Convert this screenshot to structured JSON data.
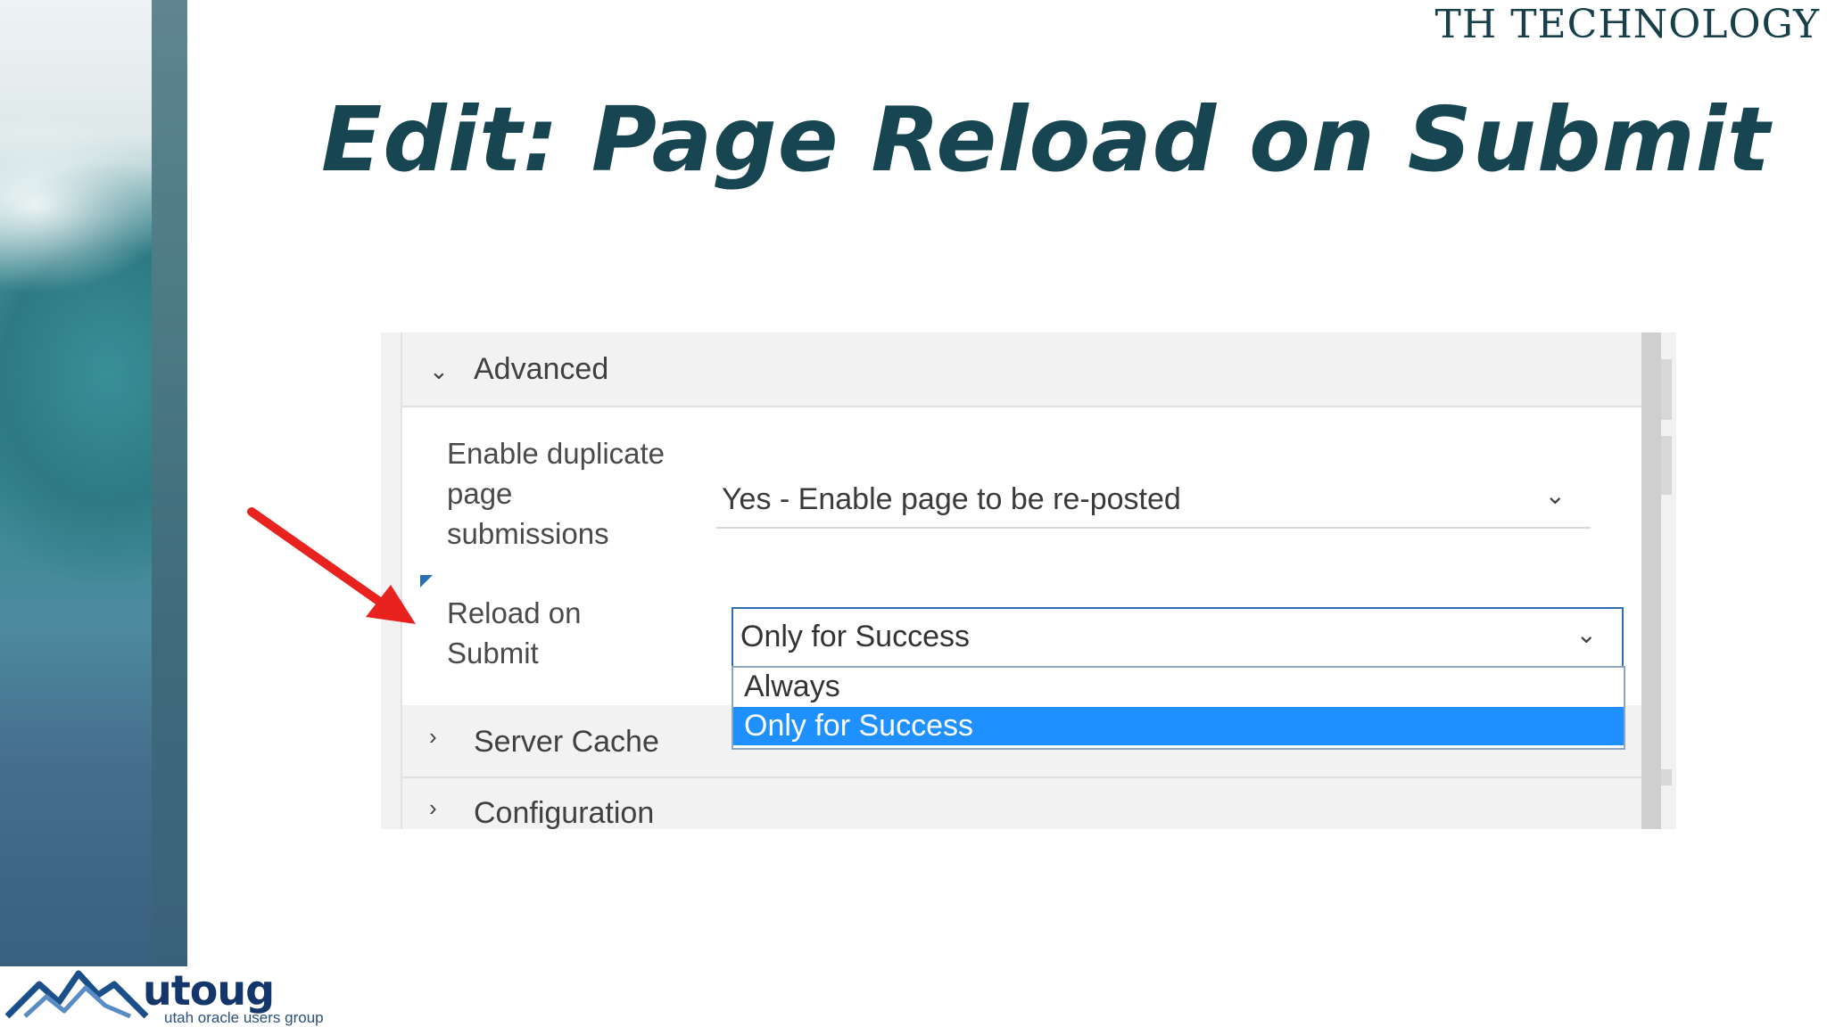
{
  "brand": "TH TECHNOLOGY",
  "slide_title": "Edit: Page Reload on Submit",
  "panel": {
    "advanced_section": "Advanced",
    "dup_label_lines": [
      "Enable duplicate",
      "page",
      "submissions"
    ],
    "dup_value": "Yes - Enable page to be re-posted",
    "reload_label_lines": [
      "Reload on",
      "Submit"
    ],
    "reload_value": "Only for Success",
    "dropdown_options": [
      "Always",
      "Only for Success"
    ],
    "dropdown_selected": "Only for Success",
    "server_cache_section": "Server Cache",
    "configuration_section": "Configuration"
  },
  "logo": {
    "word": "utoug",
    "tagline": "utah oracle users group"
  },
  "colors": {
    "title": "#174552",
    "selected_option": "#1e90ff",
    "arrow": "#e8231f",
    "focus_border": "#2f6fb0"
  }
}
